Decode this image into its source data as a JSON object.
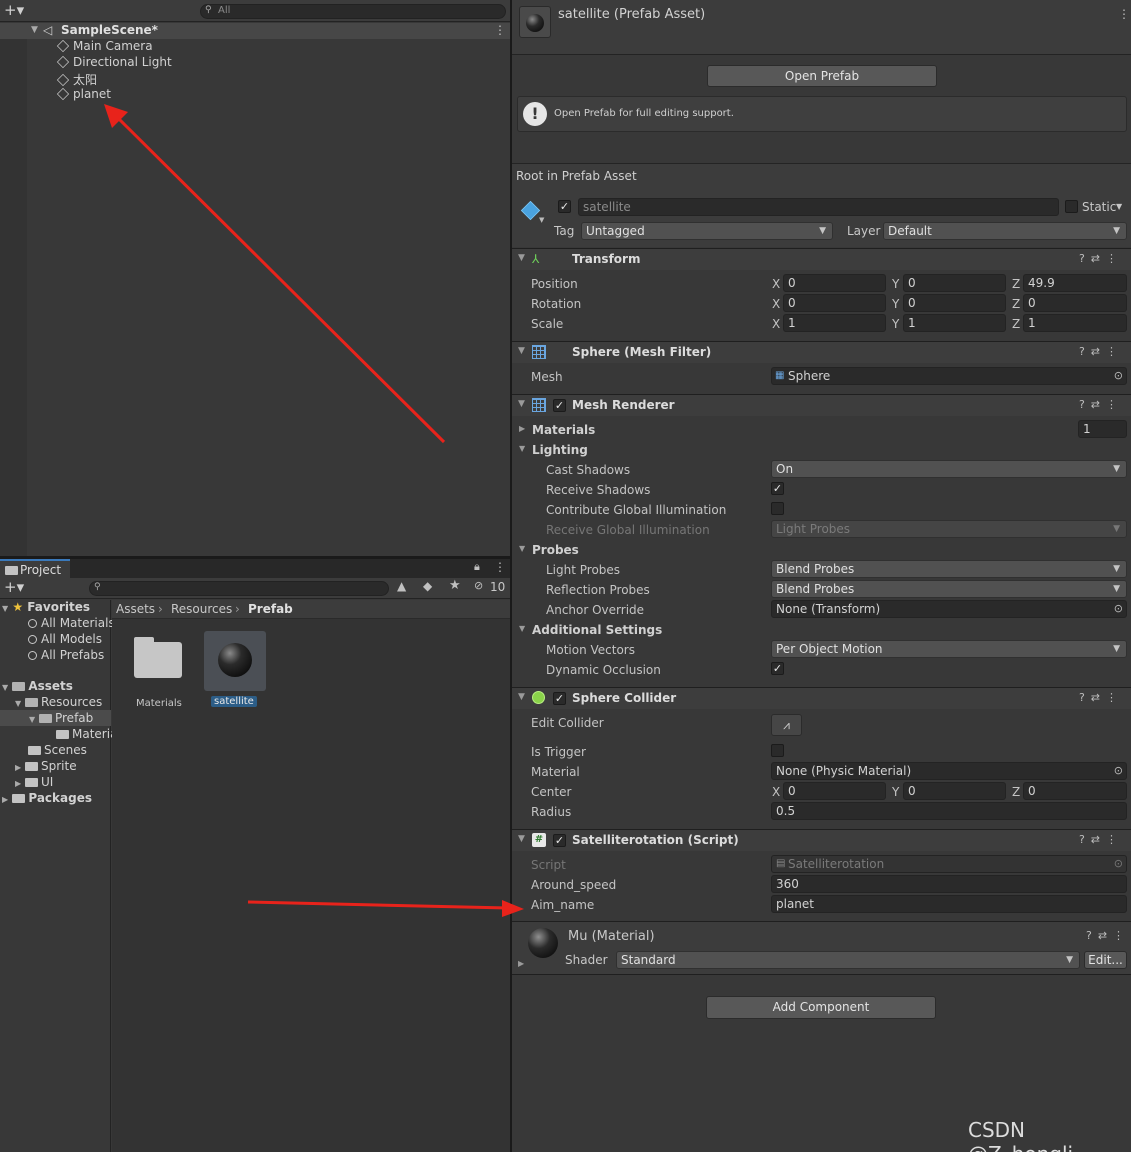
{
  "hierarchy": {
    "search_placeholder": "All",
    "scene_name": "SampleScene*",
    "items": [
      "Main Camera",
      "Directional Light",
      "太阳",
      "planet"
    ]
  },
  "project": {
    "tab_label": "Project",
    "filter_count": "10",
    "favorites_label": "Favorites",
    "favorites": [
      "All Materials",
      "All Models",
      "All Prefabs"
    ],
    "assets_label": "Assets",
    "tree": [
      {
        "label": "Resources",
        "indent": 1
      },
      {
        "label": "Prefab",
        "indent": 2
      },
      {
        "label": "Materials",
        "indent": 3
      },
      {
        "label": "Scenes",
        "indent": 1
      },
      {
        "label": "Sprite",
        "indent": 1
      },
      {
        "label": "UI",
        "indent": 1
      }
    ],
    "packages_label": "Packages",
    "breadcrumb": [
      "Assets",
      "Resources",
      "Prefab"
    ],
    "grid_items": [
      {
        "label": "Materials",
        "kind": "folder"
      },
      {
        "label": "satellite",
        "kind": "sphere",
        "selected": true
      }
    ]
  },
  "inspector": {
    "title": "satellite (Prefab Asset)",
    "open_prefab_button": "Open Prefab",
    "info_message": "Open Prefab for full editing support.",
    "root_label": "Root in Prefab Asset",
    "object_name": "satellite",
    "static_label": "Static",
    "tag_label": "Tag",
    "tag_value": "Untagged",
    "layer_label": "Layer",
    "layer_value": "Default",
    "transform": {
      "title": "Transform",
      "position_label": "Position",
      "position": [
        "0",
        "0",
        "49.9"
      ],
      "rotation_label": "Rotation",
      "rotation": [
        "0",
        "0",
        "0"
      ],
      "scale_label": "Scale",
      "scale": [
        "1",
        "1",
        "1"
      ]
    },
    "mesh_filter": {
      "title": "Sphere (Mesh Filter)",
      "mesh_label": "Mesh",
      "mesh_value": "Sphere"
    },
    "mesh_renderer": {
      "title": "Mesh Renderer",
      "materials_label": "Materials",
      "materials_count": "1",
      "lighting_label": "Lighting",
      "cast_shadows_label": "Cast Shadows",
      "cast_shadows": "On",
      "receive_shadows_label": "Receive Shadows",
      "contribute_gi_label": "Contribute Global Illumination",
      "receive_gi_label": "Receive Global Illumination",
      "receive_gi": "Light Probes",
      "probes_label": "Probes",
      "light_probes_label": "Light Probes",
      "light_probes": "Blend Probes",
      "reflection_probes_label": "Reflection Probes",
      "reflection_probes": "Blend Probes",
      "anchor_override_label": "Anchor Override",
      "anchor_override": "None (Transform)",
      "additional_label": "Additional Settings",
      "motion_vectors_label": "Motion Vectors",
      "motion_vectors": "Per Object Motion",
      "dynamic_occlusion_label": "Dynamic Occlusion"
    },
    "sphere_collider": {
      "title": "Sphere Collider",
      "edit_collider_label": "Edit Collider",
      "is_trigger_label": "Is Trigger",
      "material_label": "Material",
      "material_value": "None (Physic Material)",
      "center_label": "Center",
      "center": [
        "0",
        "0",
        "0"
      ],
      "radius_label": "Radius",
      "radius": "0.5"
    },
    "script_comp": {
      "title": "Satelliterotation (Script)",
      "script_label": "Script",
      "script_value": "Satelliterotation",
      "around_speed_label": "Around_speed",
      "around_speed": "360",
      "aim_name_label": "Aim_name",
      "aim_name": "planet"
    },
    "material": {
      "title": "Mu (Material)",
      "shader_label": "Shader",
      "shader_value": "Standard",
      "edit_button": "Edit..."
    },
    "add_component_button": "Add Component"
  },
  "watermark": "CSDN @Z_hongli",
  "colors": {
    "arrow": "#e8231b",
    "selection": "#2c5d87"
  }
}
